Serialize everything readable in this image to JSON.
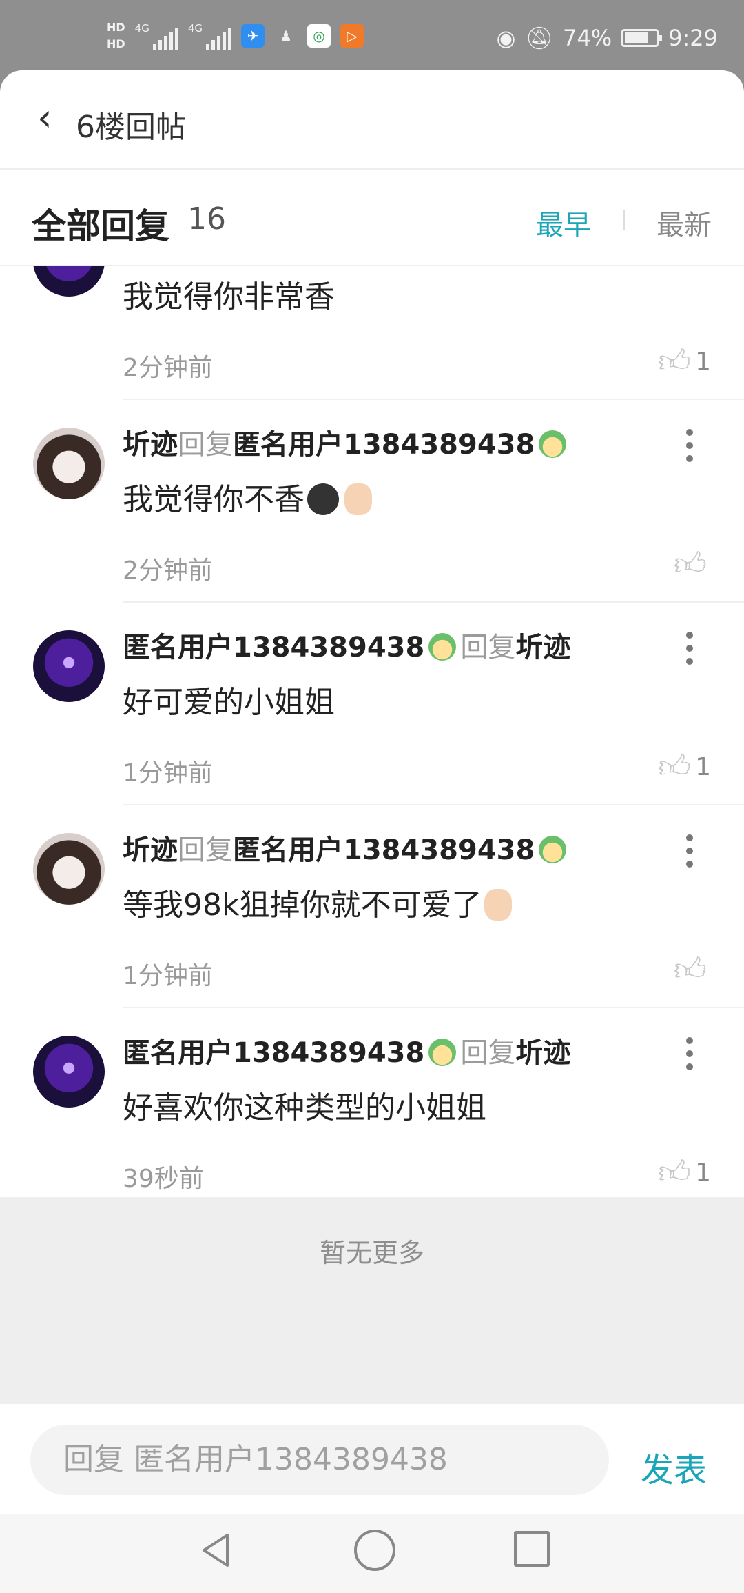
{
  "status_bar": {
    "hd1": "HD",
    "hd2": "HD",
    "net1": "4G",
    "net2": "4G",
    "battery": "74%",
    "battery_level": 0.74,
    "time": "9:29",
    "icons": [
      "hd-icon",
      "signal-icon",
      "app-icon-blue",
      "qq-icon",
      "browser-icon",
      "video-icon",
      "eye-icon",
      "mute-bell-icon",
      "battery-icon"
    ]
  },
  "topbar": {
    "title": "6楼回帖",
    "back_icon": "chevron-left-icon"
  },
  "header": {
    "title": "全部回复",
    "count": "16",
    "sort_earliest": "最早",
    "sort_latest": "最新"
  },
  "comments": [
    {
      "text": "我觉得你非常香",
      "time": "2分钟前",
      "likes": "1"
    },
    {
      "user": "圻迹",
      "reply_word": "回复",
      "target": "匿名用户1384389438",
      "text": "我觉得你不香",
      "time": "2分钟前",
      "likes": ""
    },
    {
      "user": "匿名用户1384389438",
      "reply_word": "回复",
      "target": "圻迹",
      "text": "好可爱的小姐姐",
      "time": "1分钟前",
      "likes": "1"
    },
    {
      "user": "圻迹",
      "reply_word": "回复",
      "target": "匿名用户1384389438",
      "text": "等我98k狙掉你就不可爱了",
      "time": "1分钟前",
      "likes": ""
    },
    {
      "user": "匿名用户1384389438",
      "reply_word": "回复",
      "target": "圻迹",
      "text": "好喜欢你这种类型的小姐姐",
      "time": "39秒前",
      "likes": "1"
    }
  ],
  "footer_note": "暂无更多",
  "input": {
    "placeholder": "回复 匿名用户1384389438",
    "send": "发表"
  },
  "colors": {
    "accent": "#1aa5b8",
    "status_bg": "#8f8f8f",
    "divider": "#efefef"
  }
}
